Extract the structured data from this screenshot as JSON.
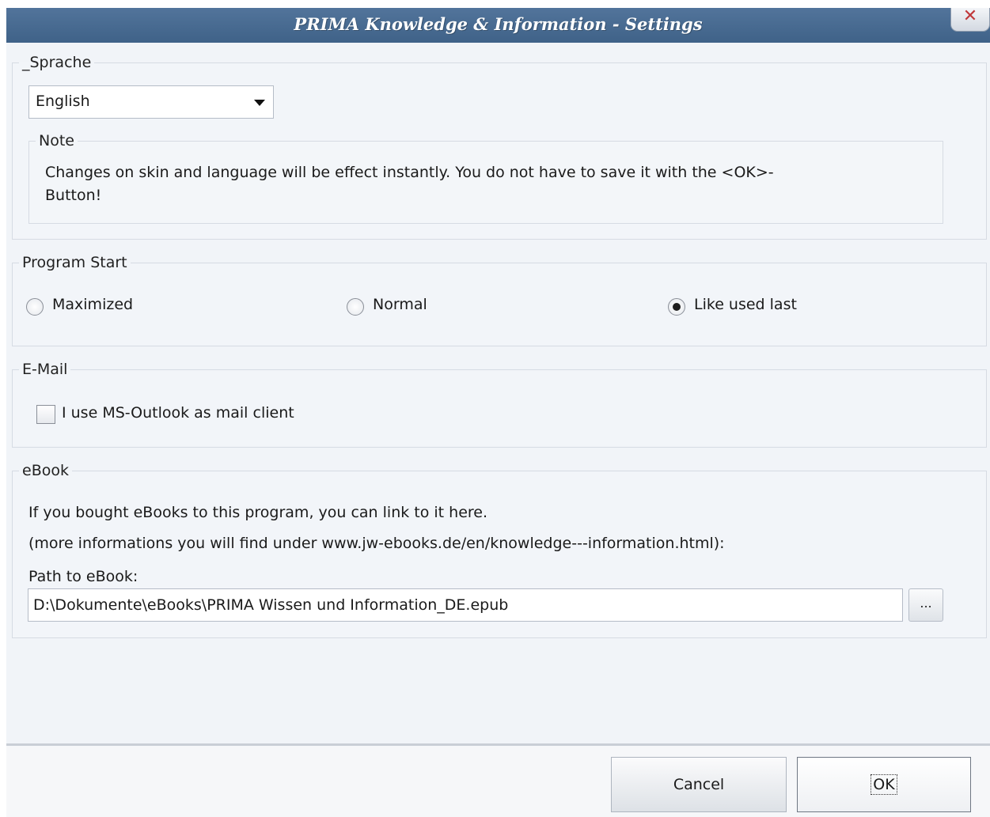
{
  "window": {
    "title": "PRIMA Knowledge & Information - Settings",
    "close_label": "✕"
  },
  "language": {
    "legend": "_Sprache",
    "selected": "English",
    "note_legend": "Note",
    "note_text": "Changes on skin and language will be effect instantly. You do not have to save it with the <OK>-Button!"
  },
  "program_start": {
    "legend": "Program Start",
    "options": [
      {
        "label": "Maximized",
        "checked": false
      },
      {
        "label": "Normal",
        "checked": false
      },
      {
        "label": "Like used last",
        "checked": true
      }
    ]
  },
  "email": {
    "legend": "E-Mail",
    "outlook_label": "I use MS-Outlook as mail client",
    "outlook_checked": false
  },
  "ebook": {
    "legend": "eBook",
    "line1": "If you bought eBooks to this program, you can link to it here.",
    "line2": "(more informations you will find under www.jw-ebooks.de/en/knowledge---information.html):",
    "path_label": "Path to eBook:",
    "path_value": "D:\\Dokumente\\eBooks\\PRIMA Wissen und Information_DE.epub",
    "browse_label": "..."
  },
  "buttons": {
    "cancel": "Cancel",
    "ok": "OK"
  }
}
